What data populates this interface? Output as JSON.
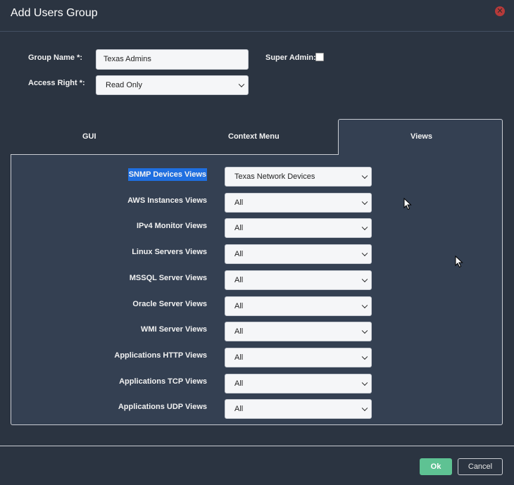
{
  "dialog": {
    "title": "Add Users Group",
    "close_icon": "close-icon",
    "close_symbol": "✕"
  },
  "form": {
    "group_name_label": "Group Name *:",
    "group_name_value": "Texas Admins",
    "super_admin_label": "Super Admin:",
    "super_admin_checked": false,
    "access_right_label": "Access Right *:",
    "access_right_value": "Read Only"
  },
  "tabs": [
    {
      "label": "GUI",
      "active": false
    },
    {
      "label": "Context Menu",
      "active": false
    },
    {
      "label": "Views",
      "active": true
    }
  ],
  "views_rows": [
    {
      "label": "SNMP Devices Views",
      "value": "Texas Network Devices",
      "highlighted": true
    },
    {
      "label": "AWS Instances Views",
      "value": "All"
    },
    {
      "label": "IPv4 Monitor Views",
      "value": "All"
    },
    {
      "label": "Linux Servers Views",
      "value": "All"
    },
    {
      "label": "MSSQL Server Views",
      "value": "All"
    },
    {
      "label": "Oracle Server Views",
      "value": "All"
    },
    {
      "label": "WMI Server Views",
      "value": "All"
    },
    {
      "label": "Applications HTTP Views",
      "value": "All"
    },
    {
      "label": "Applications TCP Views",
      "value": "All"
    },
    {
      "label": "Applications UDP Views",
      "value": "All"
    }
  ],
  "footer": {
    "ok_label": "Ok",
    "cancel_label": "Cancel"
  },
  "colors": {
    "background": "#2b3441",
    "panel": "#344052",
    "highlight": "#1f6fe0",
    "ok": "#5ec293",
    "close": "#b63a3a"
  }
}
